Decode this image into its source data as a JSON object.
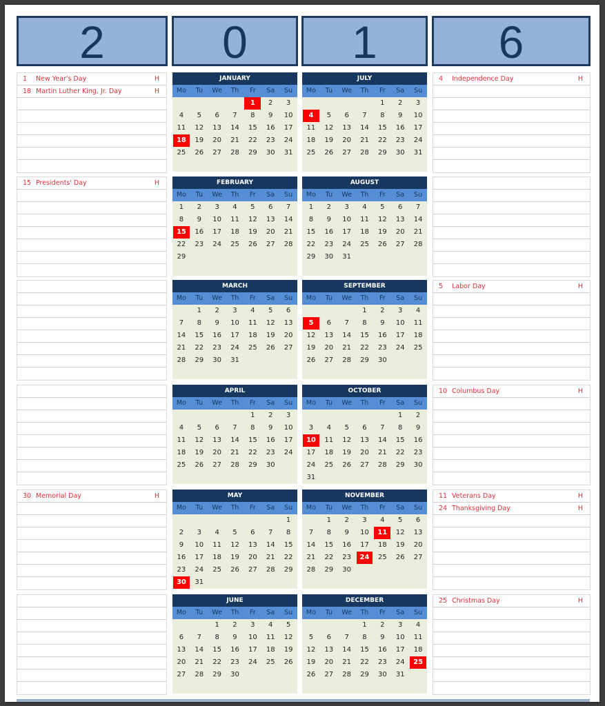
{
  "year_digits": [
    "2",
    "0",
    "1",
    "6"
  ],
  "weekday_labels": [
    "Mo",
    "Tu",
    "We",
    "Th",
    "Fr",
    "Sa",
    "Su"
  ],
  "holiday_marker": "H",
  "colors": {
    "digit_box_fill": "#95b3d7",
    "digit_box_border": "#1f3a5f",
    "month_header": "#17375e",
    "weekday_band": "#558ed5",
    "month_body": "#ebeedd",
    "holiday_highlight": "#ff0000",
    "holiday_text": "#e0303a"
  },
  "months": [
    {
      "name": "JANUARY",
      "offset": 4,
      "days": 31,
      "holidays": [
        1,
        18
      ]
    },
    {
      "name": "FEBRUARY",
      "offset": 0,
      "days": 29,
      "holidays": [
        15
      ]
    },
    {
      "name": "MARCH",
      "offset": 1,
      "days": 31,
      "holidays": []
    },
    {
      "name": "APRIL",
      "offset": 4,
      "days": 30,
      "holidays": []
    },
    {
      "name": "MAY",
      "offset": 6,
      "days": 31,
      "holidays": [
        30
      ]
    },
    {
      "name": "JUNE",
      "offset": 2,
      "days": 30,
      "holidays": []
    },
    {
      "name": "JULY",
      "offset": 4,
      "days": 31,
      "holidays": [
        4
      ]
    },
    {
      "name": "AUGUST",
      "offset": 0,
      "days": 31,
      "holidays": []
    },
    {
      "name": "SEPTEMBER",
      "offset": 3,
      "days": 30,
      "holidays": [
        5
      ]
    },
    {
      "name": "OCTOBER",
      "offset": 5,
      "days": 31,
      "holidays": [
        10
      ]
    },
    {
      "name": "NOVEMBER",
      "offset": 1,
      "days": 30,
      "holidays": [
        11,
        24
      ]
    },
    {
      "name": "DECEMBER",
      "offset": 3,
      "days": 31,
      "holidays": [
        25
      ]
    }
  ],
  "holiday_lists": {
    "left": [
      [
        {
          "day": "1",
          "name": "New Year's Day",
          "flag": "H"
        },
        {
          "day": "18",
          "name": "Martin Luther King, Jr. Day",
          "flag": "H"
        }
      ],
      [
        {
          "day": "15",
          "name": "Presidents' Day",
          "flag": "H"
        }
      ],
      [],
      [],
      [
        {
          "day": "30",
          "name": "Memorial Day",
          "flag": "H"
        }
      ],
      []
    ],
    "right": [
      [
        {
          "day": "4",
          "name": "Independence Day",
          "flag": "H"
        }
      ],
      [],
      [
        {
          "day": "5",
          "name": "Labor Day",
          "flag": "H"
        }
      ],
      [
        {
          "day": "10",
          "name": "Columbus Day",
          "flag": "H"
        }
      ],
      [
        {
          "day": "11",
          "name": "Veterans Day",
          "flag": "H"
        },
        {
          "day": "24",
          "name": "Thanksgiving Day",
          "flag": "H"
        }
      ],
      [
        {
          "day": "25",
          "name": "Christmas Day",
          "flag": "H"
        }
      ]
    ]
  }
}
